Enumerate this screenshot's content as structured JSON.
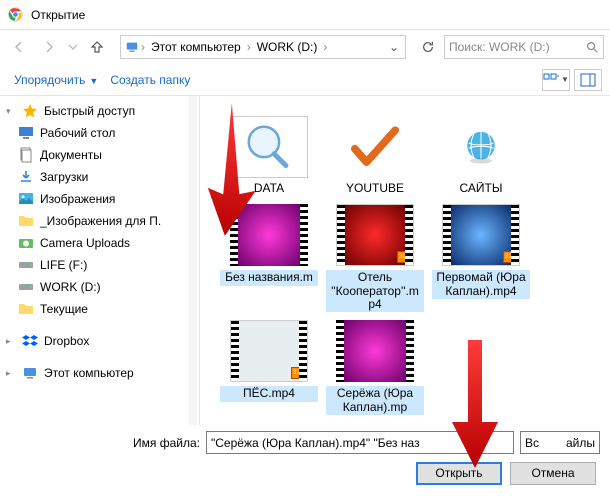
{
  "title": "Открытие",
  "breadcrumb": {
    "pc": "Этот компьютер",
    "drive": "WORK (D:)"
  },
  "search": {
    "placeholder": "Поиск: WORK (D:)"
  },
  "toolbar": {
    "organize": "Упорядочить",
    "new_folder": "Создать папку"
  },
  "sidebar": {
    "quick": "Быстрый доступ",
    "desktop": "Рабочий стол",
    "documents": "Документы",
    "downloads": "Загрузки",
    "pictures": "Изображения",
    "pictures_for": "_Изображения для П.",
    "camera": "Camera Uploads",
    "life": "LIFE (F:)",
    "work": "WORK (D:)",
    "current": "Текущие",
    "dropbox": "Dropbox",
    "this_pc": "Этот компьютер"
  },
  "items": {
    "folders": [
      {
        "name": "DATA",
        "icon": "magnifier"
      },
      {
        "name": "YOUTUBE",
        "icon": "check"
      },
      {
        "name": "САЙТЫ",
        "icon": "globe"
      },
      {
        "name": "Без названия.m",
        "icon": "video-pink",
        "cut": true
      }
    ],
    "videos": [
      {
        "name": "Отель ''Кооператор''.mp4",
        "thumb": "red",
        "selected": true
      },
      {
        "name": "Первомай (Юра Каплан).mp4",
        "thumb": "blue",
        "selected": true
      },
      {
        "name": "ПЁС.mp4",
        "thumb": "white",
        "selected": true
      },
      {
        "name": "Серёжа (Юра Каплан).mp",
        "thumb": "pink",
        "selected": true,
        "cut": true
      }
    ]
  },
  "footer": {
    "fname_label": "Имя файла:",
    "fname_value": "\"Серёжа (Юра Каплан).mp4\" \"Без наз",
    "filter": "Все файлы",
    "filter_short": "Вс",
    "filter_suffix": "айлы",
    "open": "Открыть",
    "cancel": "Отмена"
  }
}
